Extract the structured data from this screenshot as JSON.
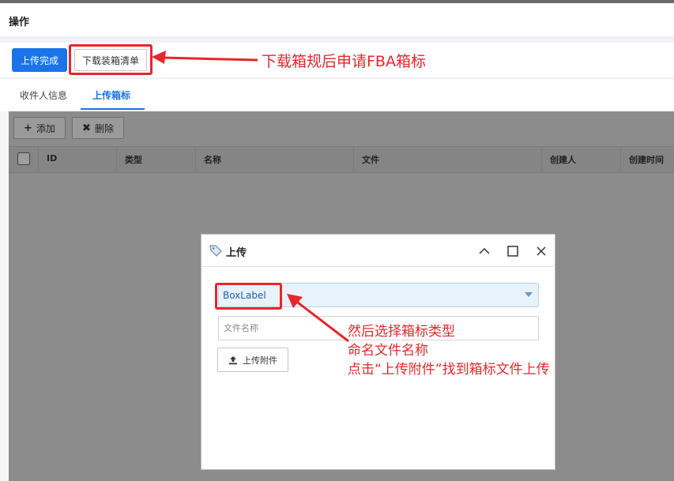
{
  "header": {
    "title": "操作"
  },
  "toolbar": {
    "upload_complete": "上传完成",
    "download_list": "下载装箱清单"
  },
  "annotations": {
    "note1": "下载箱规后申请FBA箱标",
    "note2_line1": "然后选择箱标类型",
    "note2_line2": "命名文件名称",
    "note2_line3": "点击“上传附件”找到箱标文件上传",
    "color": "#e8262b"
  },
  "tabs": [
    {
      "label": "收件人信息",
      "active": false
    },
    {
      "label": "上传箱标",
      "active": true
    }
  ],
  "grid": {
    "add_label": "添加",
    "delete_label": "删除",
    "columns": [
      "ID",
      "类型",
      "名称",
      "文件",
      "创建人",
      "创建时间"
    ]
  },
  "dialog": {
    "title": "上传",
    "select_value": "BoxLabel",
    "filename_placeholder": "文件名称",
    "upload_attachment": "上传附件"
  },
  "colors": {
    "primary": "#1a73e8",
    "mask": "#8c8c8c"
  }
}
